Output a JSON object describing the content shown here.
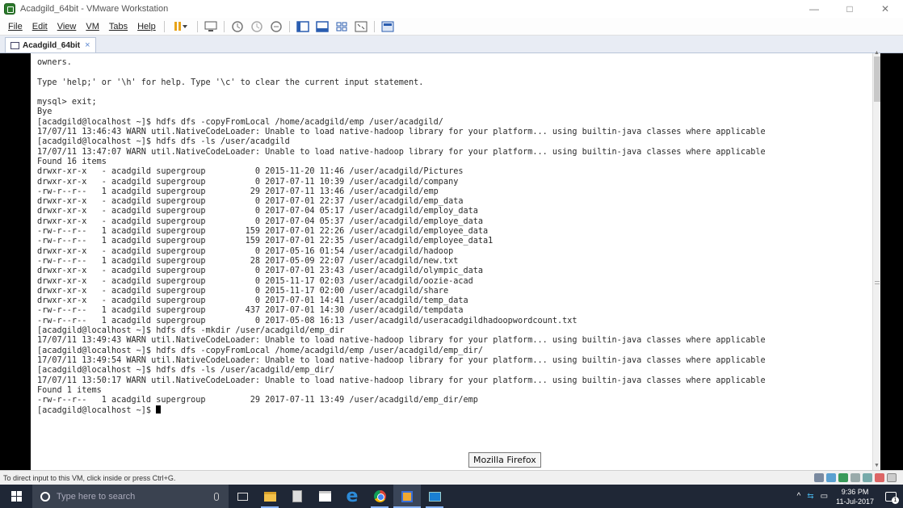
{
  "window": {
    "title": "Acadgild_64bit - VMware Workstation",
    "controls": {
      "minimize": "—",
      "maximize": "□",
      "close": "✕"
    }
  },
  "menu": {
    "items": [
      "File",
      "Edit",
      "View",
      "VM",
      "Tabs",
      "Help"
    ]
  },
  "toolbar": {
    "icons": [
      "pause-icon",
      "send-ctrl-alt-del-icon",
      "snapshot-icon",
      "revert-snapshot-icon",
      "snapshot-manager-icon",
      "console-view-icon",
      "fullscreen-icon",
      "unity-icon",
      "stretch-icon",
      "thumbnail-icon"
    ]
  },
  "tab": {
    "label": "Acadgild_64bit",
    "close": "×"
  },
  "terminal": {
    "lines": [
      "owners.",
      "",
      "Type 'help;' or '\\h' for help. Type '\\c' to clear the current input statement.",
      "",
      "mysql> exit;",
      "Bye",
      "[acadgild@localhost ~]$ hdfs dfs -copyFromLocal /home/acadgild/emp /user/acadgild/",
      "17/07/11 13:46:43 WARN util.NativeCodeLoader: Unable to load native-hadoop library for your platform... using builtin-java classes where applicable",
      "[acadgild@localhost ~]$ hdfs dfs -ls /user/acadgild",
      "17/07/11 13:47:07 WARN util.NativeCodeLoader: Unable to load native-hadoop library for your platform... using builtin-java classes where applicable",
      "Found 16 items",
      "drwxr-xr-x   - acadgild supergroup          0 2015-11-20 11:46 /user/acadgild/Pictures",
      "drwxr-xr-x   - acadgild supergroup          0 2017-07-11 10:39 /user/acadgild/company",
      "-rw-r--r--   1 acadgild supergroup         29 2017-07-11 13:46 /user/acadgild/emp",
      "drwxr-xr-x   - acadgild supergroup          0 2017-07-01 22:37 /user/acadgild/emp_data",
      "drwxr-xr-x   - acadgild supergroup          0 2017-07-04 05:17 /user/acadgild/employ_data",
      "drwxr-xr-x   - acadgild supergroup          0 2017-07-04 05:37 /user/acadgild/employe_data",
      "-rw-r--r--   1 acadgild supergroup        159 2017-07-01 22:26 /user/acadgild/employee_data",
      "-rw-r--r--   1 acadgild supergroup        159 2017-07-01 22:35 /user/acadgild/employee_data1",
      "drwxr-xr-x   - acadgild supergroup          0 2017-05-16 01:54 /user/acadgild/hadoop",
      "-rw-r--r--   1 acadgild supergroup         28 2017-05-09 22:07 /user/acadgild/new.txt",
      "drwxr-xr-x   - acadgild supergroup          0 2017-07-01 23:43 /user/acadgild/olympic_data",
      "drwxr-xr-x   - acadgild supergroup          0 2015-11-17 02:03 /user/acadgild/oozie-acad",
      "drwxr-xr-x   - acadgild supergroup          0 2015-11-17 02:00 /user/acadgild/share",
      "drwxr-xr-x   - acadgild supergroup          0 2017-07-01 14:41 /user/acadgild/temp_data",
      "-rw-r--r--   1 acadgild supergroup        437 2017-07-01 14:30 /user/acadgild/tempdata",
      "-rw-r--r--   1 acadgild supergroup          0 2017-05-08 16:13 /user/acadgild/useracadgildhadoopwordcount.txt",
      "[acadgild@localhost ~]$ hdfs dfs -mkdir /user/acadgild/emp_dir",
      "17/07/11 13:49:43 WARN util.NativeCodeLoader: Unable to load native-hadoop library for your platform... using builtin-java classes where applicable",
      "[acadgild@localhost ~]$ hdfs dfs -copyFromLocal /home/acadgild/emp /user/acadgild/emp_dir/",
      "17/07/11 13:49:54 WARN util.NativeCodeLoader: Unable to load native-hadoop library for your platform... using builtin-java classes where applicable",
      "[acadgild@localhost ~]$ hdfs dfs -ls /user/acadgild/emp_dir/",
      "17/07/11 13:50:17 WARN util.NativeCodeLoader: Unable to load native-hadoop library for your platform... using builtin-java classes where applicable",
      "Found 1 items",
      "-rw-r--r--   1 acadgild supergroup         29 2017-07-11 13:49 /user/acadgild/emp_dir/emp"
    ],
    "prompt": "[acadgild@localhost ~]$ "
  },
  "tooltip": "Mozilla Firefox",
  "statusbar": {
    "text": "To direct input to this VM, click inside or press Ctrl+G."
  },
  "taskbar": {
    "search_placeholder": "Type here to search",
    "clock_time": "9:36 PM",
    "clock_date": "11-Jul-2017",
    "notification_count": "1"
  }
}
